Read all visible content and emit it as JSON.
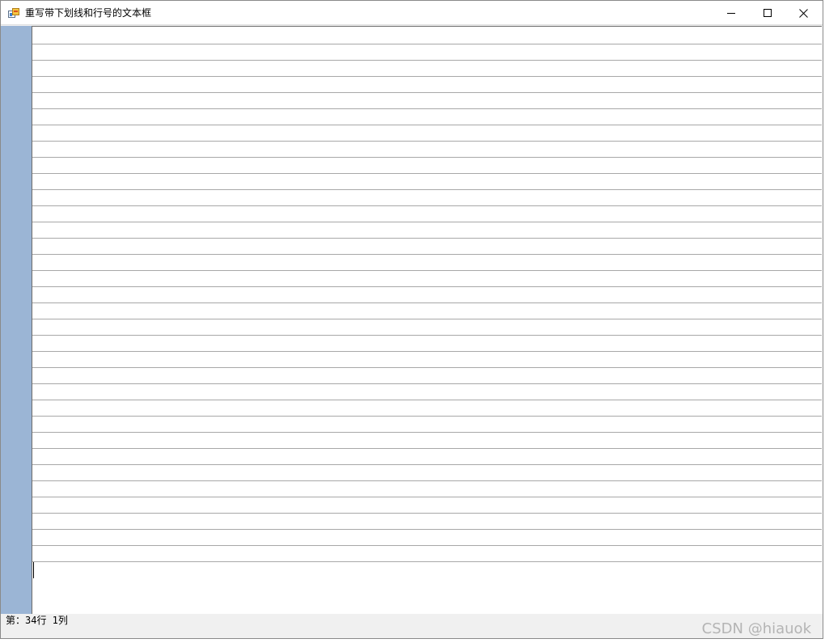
{
  "window": {
    "title": "重写带下划线和行号的文本框"
  },
  "controls": {
    "minimize_icon": "minimize-icon",
    "maximize_icon": "maximize-icon",
    "close_icon": "close-icon"
  },
  "editor": {
    "rule_line_count": 33,
    "gutter_color": "#9bb5d5",
    "rule_color": "#a8a8a8"
  },
  "status": {
    "text": "第：34行 1列"
  },
  "watermark": {
    "text": "CSDN @hiauok"
  }
}
